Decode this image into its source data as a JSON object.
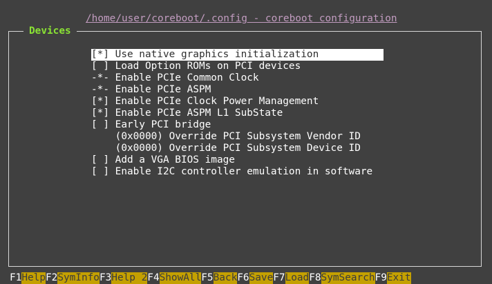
{
  "window": {
    "title": "/home/user/coreboot/.config - coreboot configuration"
  },
  "frame": {
    "label": "Devices"
  },
  "menu": {
    "items": [
      {
        "text": "[*] Use native graphics initialization",
        "selected": true
      },
      {
        "text": "[ ] Load Option ROMs on PCI devices",
        "selected": false
      },
      {
        "text": "-*- Enable PCIe Common Clock",
        "selected": false
      },
      {
        "text": "-*- Enable PCIe ASPM",
        "selected": false
      },
      {
        "text": "[*] Enable PCIe Clock Power Management",
        "selected": false
      },
      {
        "text": "[*] Enable PCIe ASPM L1 SubState",
        "selected": false
      },
      {
        "text": "[ ] Early PCI bridge",
        "selected": false
      },
      {
        "text": "    (0x0000) Override PCI Subsystem Vendor ID",
        "selected": false
      },
      {
        "text": "    (0x0000) Override PCI Subsystem Device ID",
        "selected": false
      },
      {
        "text": "[ ] Add a VGA BIOS image",
        "selected": false
      },
      {
        "text": "[ ] Enable I2C controller emulation in software",
        "selected": false
      }
    ]
  },
  "keybar": {
    "keys": [
      {
        "code": "F1",
        "label": "Help"
      },
      {
        "code": "F2",
        "label": "SymInfo"
      },
      {
        "code": "F3",
        "label": "Help 2"
      },
      {
        "code": "F4",
        "label": "ShowAll"
      },
      {
        "code": "F5",
        "label": "Back"
      },
      {
        "code": "F6",
        "label": "Save"
      },
      {
        "code": "F7",
        "label": "Load"
      },
      {
        "code": "F8",
        "label": "SymSearch"
      },
      {
        "code": "F9",
        "label": "Exit"
      }
    ]
  },
  "colors": {
    "background": "#404040",
    "title": "#c29cc0",
    "frame_label": "#8ae234",
    "key_label_bg": "#c4a000",
    "selected_bg": "#ffffff"
  }
}
